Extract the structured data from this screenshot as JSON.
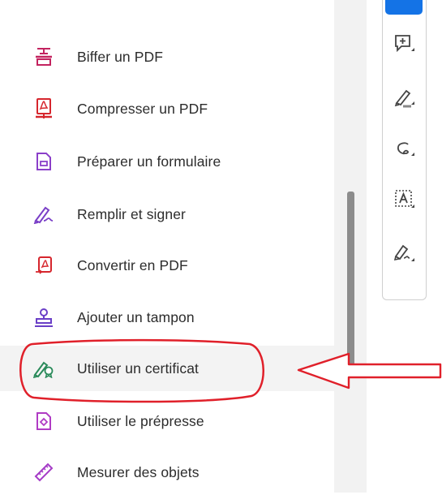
{
  "menu": {
    "items": [
      {
        "label": "Biffer un PDF",
        "icon": "redact-icon",
        "color": "#c3235f"
      },
      {
        "label": "Compresser un PDF",
        "icon": "compress-pdf-icon",
        "color": "#d6262d"
      },
      {
        "label": "Préparer un formulaire",
        "icon": "prepare-form-icon",
        "color": "#8b3fc9"
      },
      {
        "label": "Remplir et signer",
        "icon": "fill-sign-icon",
        "color": "#7a3fc7"
      },
      {
        "label": "Convertir en PDF",
        "icon": "convert-pdf-icon",
        "color": "#d6262d"
      },
      {
        "label": "Ajouter un tampon",
        "icon": "stamp-icon",
        "color": "#6a3fc7"
      },
      {
        "label": "Utiliser un certificat",
        "icon": "certificate-icon",
        "color": "#2a8a5a",
        "highlighted": true
      },
      {
        "label": "Utiliser le prépresse",
        "icon": "print-production-icon",
        "color": "#b03bc4"
      },
      {
        "label": "Mesurer des objets",
        "icon": "ruler-icon",
        "color": "#a53cc7"
      }
    ]
  },
  "toolbar": {
    "accent": "#1473e6",
    "tools": [
      {
        "icon": "add-comment-icon"
      },
      {
        "icon": "highlighter-icon"
      },
      {
        "icon": "lasso-draw-icon"
      },
      {
        "icon": "text-box-icon"
      },
      {
        "icon": "signature-pen-icon"
      }
    ]
  },
  "annotation": {
    "color": "#e0202a"
  }
}
